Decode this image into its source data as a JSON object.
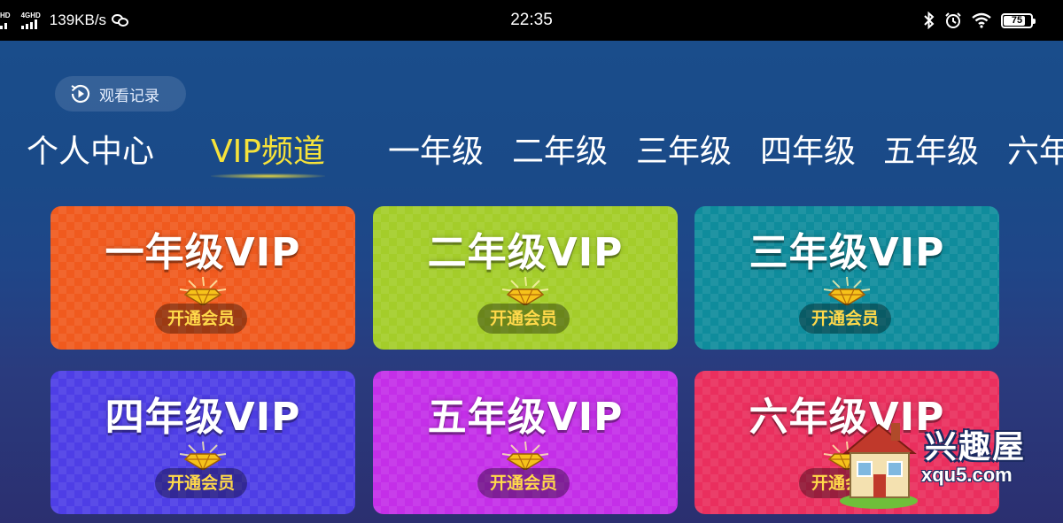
{
  "status_bar": {
    "signal1_tag": "HD",
    "signal2_tag": "4GHD",
    "net_speed": "139KB/s",
    "time": "22:35",
    "battery": "75",
    "icons": [
      "signal-icon",
      "signal-icon",
      "wechat-icon",
      "bluetooth-icon",
      "alarm-icon",
      "wifi-icon",
      "battery-icon"
    ]
  },
  "history": {
    "label": "观看记录",
    "icon": "play-history-icon"
  },
  "tabs": [
    {
      "label": "个人中心"
    },
    {
      "label": "VIP频道",
      "active": true
    },
    {
      "label": "一年级"
    },
    {
      "label": "二年级"
    },
    {
      "label": "三年级"
    },
    {
      "label": "四年级"
    },
    {
      "label": "五年级"
    },
    {
      "label": "六年级"
    }
  ],
  "cards": [
    {
      "title": "一年级VIP",
      "button": "开通会员",
      "color": "#f05a1e"
    },
    {
      "title": "二年级VIP",
      "button": "开通会员",
      "color": "#a4cd2a"
    },
    {
      "title": "三年级VIP",
      "button": "开通会员",
      "color": "#0f8c9c"
    },
    {
      "title": "四年级VIP",
      "button": "开通会员",
      "color": "#4e3ee6"
    },
    {
      "title": "五年级VIP",
      "button": "开通会员",
      "color": "#c42fe8"
    },
    {
      "title": "六年级VIP",
      "button": "开通会员",
      "color": "#ea2f5e"
    }
  ],
  "watermark": {
    "brand": "兴趣屋",
    "url": "xqu5.com"
  },
  "colors": {
    "active_tab": "#f6e23a",
    "button_text": "#ffd94a"
  }
}
